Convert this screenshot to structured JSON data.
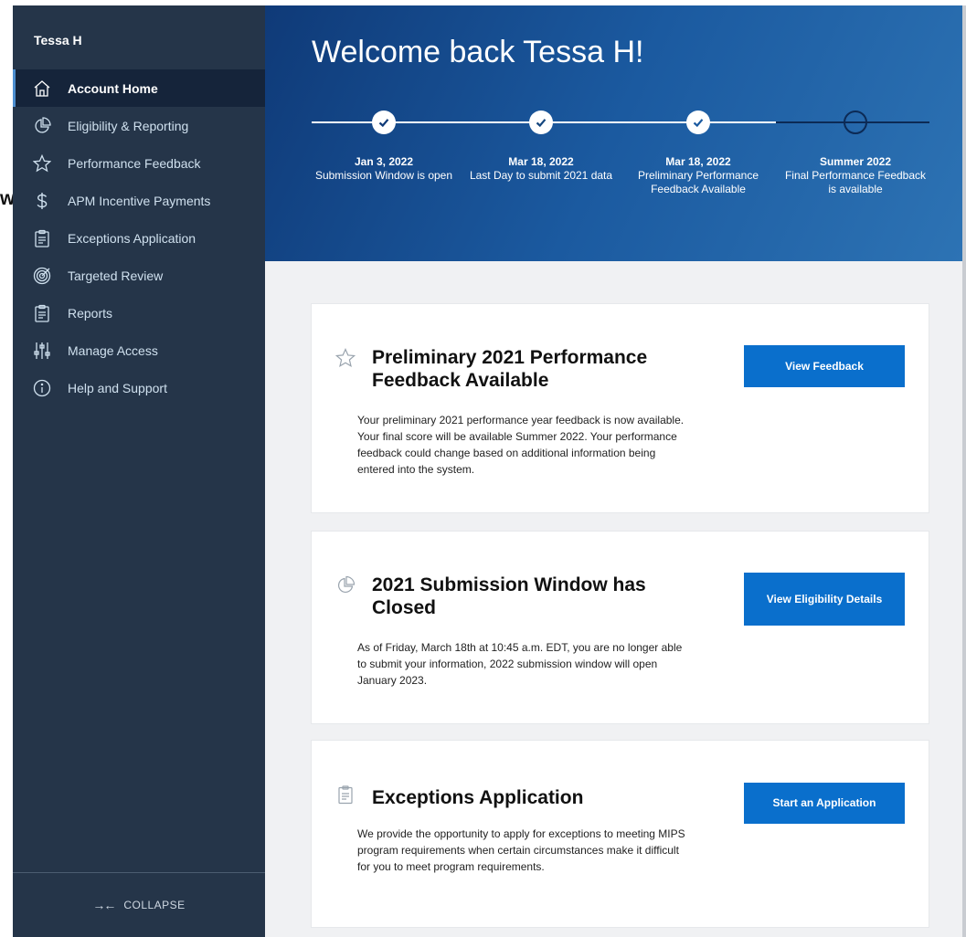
{
  "stray_char": "w",
  "sidebar": {
    "user_name": "Tessa H",
    "items": [
      {
        "label": "Account Home",
        "icon": "home-icon",
        "active": true
      },
      {
        "label": "Eligibility & Reporting",
        "icon": "pie-chart-icon",
        "active": false
      },
      {
        "label": "Performance Feedback",
        "icon": "star-icon",
        "active": false
      },
      {
        "label": "APM Incentive Payments",
        "icon": "dollar-icon",
        "active": false
      },
      {
        "label": "Exceptions Application",
        "icon": "clipboard-icon",
        "active": false
      },
      {
        "label": "Targeted Review",
        "icon": "target-icon",
        "active": false
      },
      {
        "label": "Reports",
        "icon": "clipboard-icon",
        "active": false
      },
      {
        "label": "Manage Access",
        "icon": "sliders-icon",
        "active": false
      },
      {
        "label": "Help and Support",
        "icon": "info-icon",
        "active": false
      }
    ],
    "collapse_label": "COLLAPSE",
    "collapse_icon": "collapse-arrows-icon"
  },
  "hero": {
    "welcome": "Welcome back Tessa H!",
    "timeline": [
      {
        "date": "Jan 3, 2022",
        "desc": "Submission Window is open",
        "done": true
      },
      {
        "date": "Mar 18, 2022",
        "desc": "Last Day to submit 2021 data",
        "done": true
      },
      {
        "date": "Mar 18, 2022",
        "desc": "Preliminary Performance Feedback Available",
        "done": true
      },
      {
        "date": "Summer 2022",
        "desc": "Final Performance Feedback is available",
        "done": false
      }
    ]
  },
  "cards": [
    {
      "icon": "star-icon",
      "title": "Preliminary 2021 Performance Feedback Available",
      "body": "Your preliminary 2021 performance year feedback is now available. Your final score will be available Summer 2022. Your performance feedback could change based on additional information being entered into the system.",
      "button": "View Feedback"
    },
    {
      "icon": "pie-chart-icon",
      "title": "2021 Submission Window has Closed",
      "body": "As of Friday, March 18th at 10:45 a.m. EDT, you are no longer able to submit your information, 2022 submission window will open January 2023.",
      "button": "View Eligibility Details"
    },
    {
      "icon": "clipboard-icon",
      "title": "Exceptions Application",
      "body": "We provide the opportunity to apply for exceptions to meeting MIPS program requirements when certain circumstances make it difficult for you to meet program requirements.",
      "button": "Start an Application"
    }
  ],
  "colors": {
    "sidebar_bg": "#253549",
    "active_bg": "#15243a",
    "hero_start": "#0f3a78",
    "hero_end": "#2d73b4",
    "button": "#0a6fcc",
    "page_bg": "#f0f1f3"
  }
}
